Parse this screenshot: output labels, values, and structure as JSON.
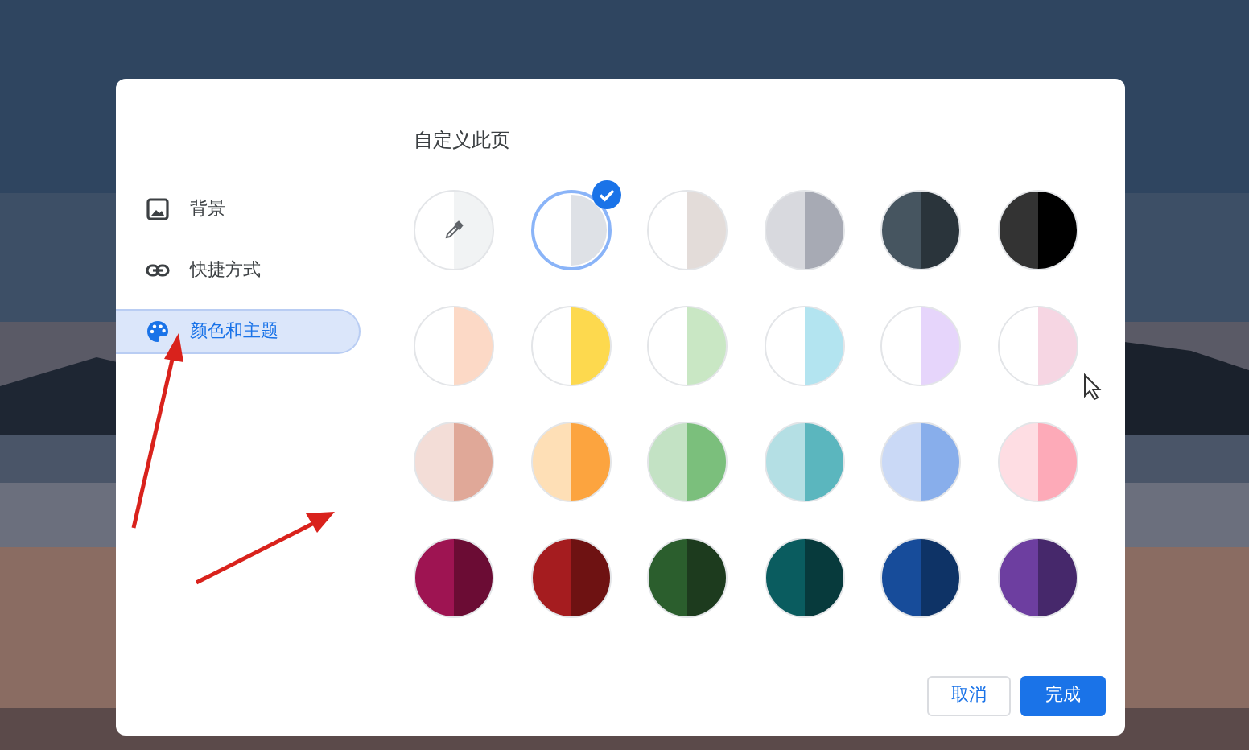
{
  "dialog": {
    "sidebar": [
      {
        "label": "背景",
        "selected": false
      },
      {
        "label": "快捷方式",
        "selected": false
      },
      {
        "label": "颜色和主题",
        "selected": true
      }
    ],
    "title": "自定义此页",
    "swatches": [
      {
        "kind": "picker",
        "halves": [
          {
            "color": "#ffffff"
          },
          {
            "color": "#f1f3f4"
          }
        ],
        "selected": false
      },
      {
        "kind": "color",
        "halves": [
          {
            "color": "#ffffff"
          },
          {
            "color": "#dee1e6"
          }
        ],
        "selected": true
      },
      {
        "kind": "color",
        "halves": [
          {
            "color": "#ffffff"
          },
          {
            "color": "#e3dcd9"
          }
        ],
        "selected": false
      },
      {
        "kind": "color",
        "halves": [
          {
            "color": "#d8d9de"
          },
          {
            "color": "#a7aab4"
          }
        ],
        "selected": false
      },
      {
        "kind": "color",
        "halves": [
          {
            "color": "#465560"
          },
          {
            "color": "#2a343b"
          }
        ],
        "selected": false
      },
      {
        "kind": "color",
        "halves": [
          {
            "color": "#333333"
          },
          {
            "color": "#000000"
          }
        ],
        "selected": false
      },
      {
        "kind": "color",
        "halves": [
          {
            "color": "#ffffff"
          },
          {
            "color": "#fcd9c6"
          }
        ],
        "selected": false
      },
      {
        "kind": "color",
        "halves": [
          {
            "color": "#ffffff"
          },
          {
            "color": "#fdd94e"
          }
        ],
        "selected": false
      },
      {
        "kind": "color",
        "halves": [
          {
            "color": "#ffffff"
          },
          {
            "color": "#c9e7c4"
          }
        ],
        "selected": false
      },
      {
        "kind": "color",
        "halves": [
          {
            "color": "#ffffff"
          },
          {
            "color": "#b3e4f0"
          }
        ],
        "selected": false
      },
      {
        "kind": "color",
        "halves": [
          {
            "color": "#ffffff"
          },
          {
            "color": "#e6d5fb"
          }
        ],
        "selected": false
      },
      {
        "kind": "color",
        "halves": [
          {
            "color": "#ffffff"
          },
          {
            "color": "#f6d6e3"
          }
        ],
        "selected": false
      },
      {
        "kind": "color",
        "halves": [
          {
            "color": "#f3ddd7"
          },
          {
            "color": "#e0a898"
          }
        ],
        "selected": false
      },
      {
        "kind": "color",
        "halves": [
          {
            "color": "#fedfb6"
          },
          {
            "color": "#fca43f"
          }
        ],
        "selected": false
      },
      {
        "kind": "color",
        "halves": [
          {
            "color": "#c3e2c4"
          },
          {
            "color": "#7bbf7c"
          }
        ],
        "selected": false
      },
      {
        "kind": "color",
        "halves": [
          {
            "color": "#b4dfe4"
          },
          {
            "color": "#5bb6be"
          }
        ],
        "selected": false
      },
      {
        "kind": "color",
        "halves": [
          {
            "color": "#cad9f6"
          },
          {
            "color": "#88aeeb"
          }
        ],
        "selected": false
      },
      {
        "kind": "color",
        "halves": [
          {
            "color": "#fedde3"
          },
          {
            "color": "#fdaab8"
          }
        ],
        "selected": false
      },
      {
        "kind": "color",
        "halves": [
          {
            "color": "#9e1452"
          },
          {
            "color": "#6b0c34"
          }
        ],
        "selected": false
      },
      {
        "kind": "color",
        "halves": [
          {
            "color": "#a51c1f"
          },
          {
            "color": "#6e1212"
          }
        ],
        "selected": false
      },
      {
        "kind": "color",
        "halves": [
          {
            "color": "#2b5e2d"
          },
          {
            "color": "#1d3b1e"
          }
        ],
        "selected": false
      },
      {
        "kind": "color",
        "halves": [
          {
            "color": "#0a5c5f"
          },
          {
            "color": "#073a3c"
          }
        ],
        "selected": false
      },
      {
        "kind": "color",
        "halves": [
          {
            "color": "#174c9a"
          },
          {
            "color": "#0e3366"
          }
        ],
        "selected": false
      },
      {
        "kind": "color",
        "halves": [
          {
            "color": "#6d3ea0"
          },
          {
            "color": "#46286b"
          }
        ],
        "selected": false
      }
    ],
    "buttons": [
      {
        "kind": "secondary",
        "label": "取消"
      },
      {
        "kind": "primary",
        "label": "完成"
      }
    ]
  }
}
